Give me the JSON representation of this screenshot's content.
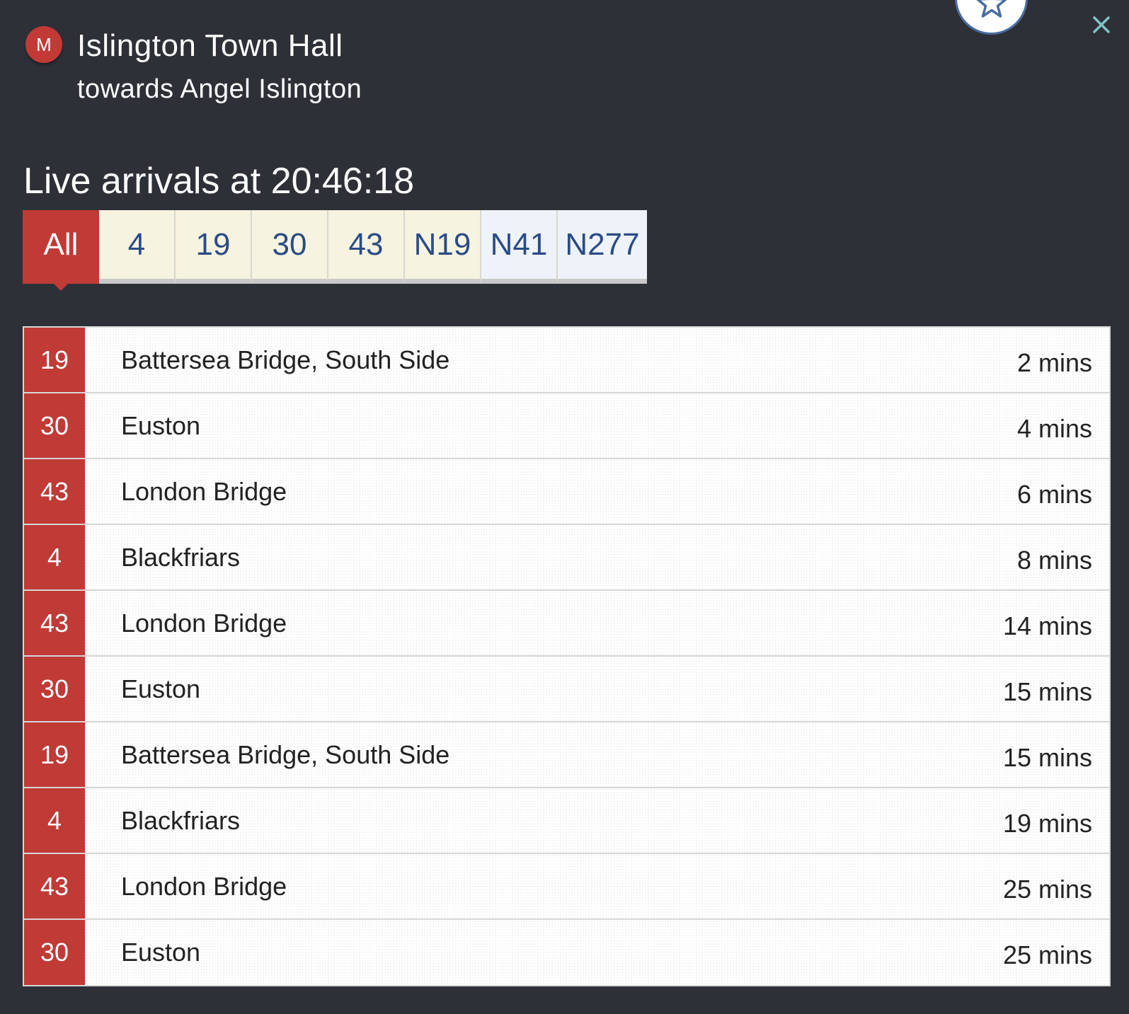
{
  "stop": {
    "badge_letter": "M",
    "name": "Islington Town Hall",
    "direction": "towards Angel Islington"
  },
  "icons": {
    "favourite": "star-icon",
    "close": "close-icon"
  },
  "live": {
    "heading": "Live arrivals at 20:46:18"
  },
  "tabs": [
    {
      "label": "All",
      "state": "active"
    },
    {
      "label": "4",
      "state": "day"
    },
    {
      "label": "19",
      "state": "day"
    },
    {
      "label": "30",
      "state": "day"
    },
    {
      "label": "43",
      "state": "day"
    },
    {
      "label": "N19",
      "state": "day"
    },
    {
      "label": "N41",
      "state": "night"
    },
    {
      "label": "N277",
      "state": "night"
    }
  ],
  "arrivals": [
    {
      "route": "19",
      "destination": "Battersea Bridge, South Side",
      "eta": "2 mins"
    },
    {
      "route": "30",
      "destination": "Euston",
      "eta": "4 mins"
    },
    {
      "route": "43",
      "destination": "London Bridge",
      "eta": "6 mins"
    },
    {
      "route": "4",
      "destination": "Blackfriars",
      "eta": "8 mins"
    },
    {
      "route": "43",
      "destination": "London Bridge",
      "eta": "14 mins"
    },
    {
      "route": "30",
      "destination": "Euston",
      "eta": "15 mins"
    },
    {
      "route": "19",
      "destination": "Battersea Bridge, South Side",
      "eta": "15 mins"
    },
    {
      "route": "4",
      "destination": "Blackfriars",
      "eta": "19 mins"
    },
    {
      "route": "43",
      "destination": "London Bridge",
      "eta": "25 mins"
    },
    {
      "route": "30",
      "destination": "Euston",
      "eta": "25 mins"
    }
  ],
  "colors": {
    "background": "#2e3038",
    "accent_red": "#c03a36",
    "tab_text_blue": "#2b4c85",
    "tab_day_bg": "#f7f3e1",
    "tab_night_bg": "#eef3fa"
  }
}
